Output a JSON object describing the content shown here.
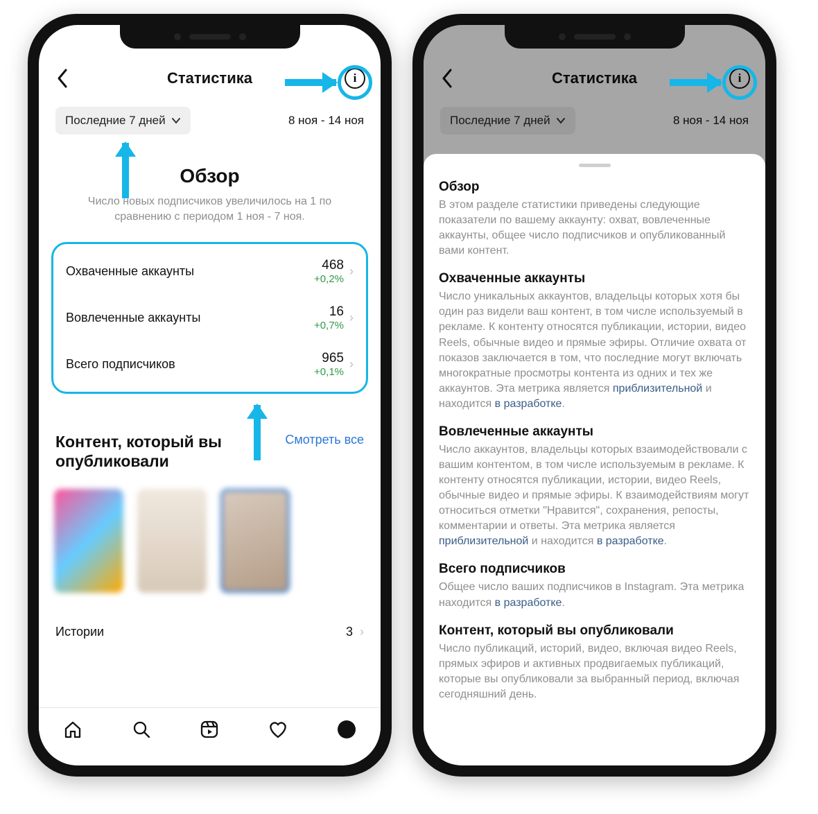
{
  "header": {
    "title": "Статистика",
    "info_glyph": "i"
  },
  "filter": {
    "chip_label": "Последние 7 дней",
    "range": "8 ноя - 14 ноя"
  },
  "overview": {
    "title": "Обзор",
    "subtext": "Число новых подписчиков увеличилось на 1 по сравнению с периодом 1 ноя - 7 ноя."
  },
  "metrics": [
    {
      "label": "Охваченные аккаунты",
      "value": "468",
      "delta": "+0,2%"
    },
    {
      "label": "Вовлеченные аккаунты",
      "value": "16",
      "delta": "+0,7%"
    },
    {
      "label": "Всего подписчиков",
      "value": "965",
      "delta": "+0,1%"
    }
  ],
  "content_section": {
    "heading": "Контент, который вы опубликовали",
    "link": "Смотреть все"
  },
  "list": {
    "stories_label": "Истории",
    "stories_count": "3"
  },
  "sheet": {
    "h_overview": "Обзор",
    "p_overview": "В этом разделе статистики приведены следующие показатели по вашему аккаунту: охват, вовлеченные аккаунты, общее число подписчиков и опубликованный вами контент.",
    "h_reach": "Охваченные аккаунты",
    "p_reach_a": "Число уникальных аккаунтов, владельцы которых хотя бы один раз видели ваш контент, в том числе используемый в рекламе. К контенту относятся публикации, истории, видео Reels, обычные видео и прямые эфиры. Отличие охвата от показов заключается в том, что последние могут включать многократные просмотры контента из одних и тех же аккаунтов. Эта метрика является ",
    "link_approx": "приблизительной",
    "p_reach_b": " и находится ",
    "link_dev": "в разработке",
    "h_engaged": "Вовлеченные аккаунты",
    "p_engaged_a": "Число аккаунтов, владельцы которых взаимодействовали с вашим контентом, в том числе используемым в рекламе. К контенту относятся публикации, истории, видео Reels, обычные видео и прямые эфиры. К взаимодействиям могут относиться отметки \"Нравится\", сохранения, репосты, комментарии и ответы. Эта метрика является ",
    "h_followers": "Всего подписчиков",
    "p_followers_a": "Общее число ваших подписчиков в Instagram. Эта метрика находится ",
    "h_content": "Контент, который вы опубликовали",
    "p_content": "Число публикаций, историй, видео, включая видео Reels, прямых эфиров и активных продвигаемых публикаций, которые вы опубликовали за выбранный период, включая сегодняшний день."
  }
}
